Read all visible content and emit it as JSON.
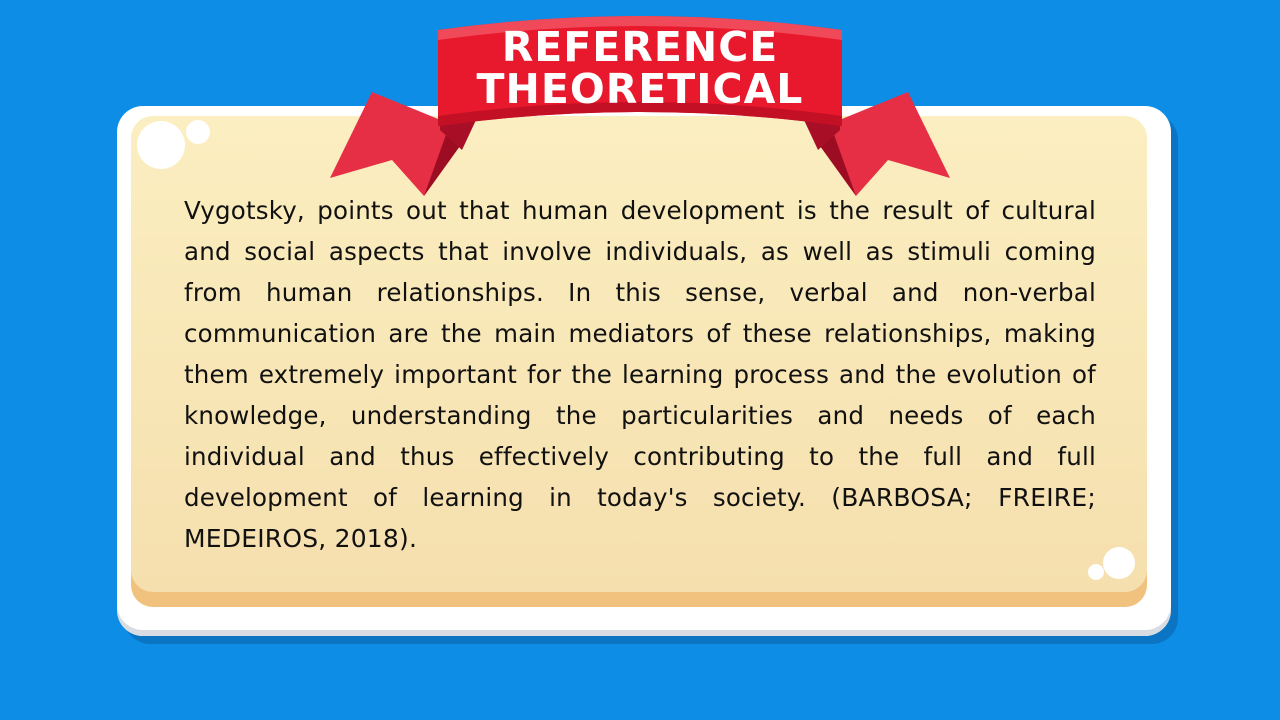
{
  "colors": {
    "background": "#0d8de6",
    "frame": "#ffffff",
    "panel": "#fbeec0",
    "panel_edge": "#f0c27d",
    "ribbon": "#e8192c",
    "ribbon_dark": "#b8102a",
    "text": "#111111"
  },
  "banner": {
    "line1": "REFERENCE",
    "line2": "THEORETICAL"
  },
  "content": {
    "paragraph": "Vygotsky, points out that human development is the result of cultural and social aspects that involve individuals, as well as stimuli coming from human relationships. In this sense, verbal and non-verbal communication are the main mediators of these relationships, making them extremely important for the learning process and the evolution of knowledge, understanding the particularities and needs of each individual and thus effectively contributing to the full and full development of learning in today's society.",
    "citation": "(BARBOSA; FREIRE; MEDEIROS, 2018)."
  }
}
